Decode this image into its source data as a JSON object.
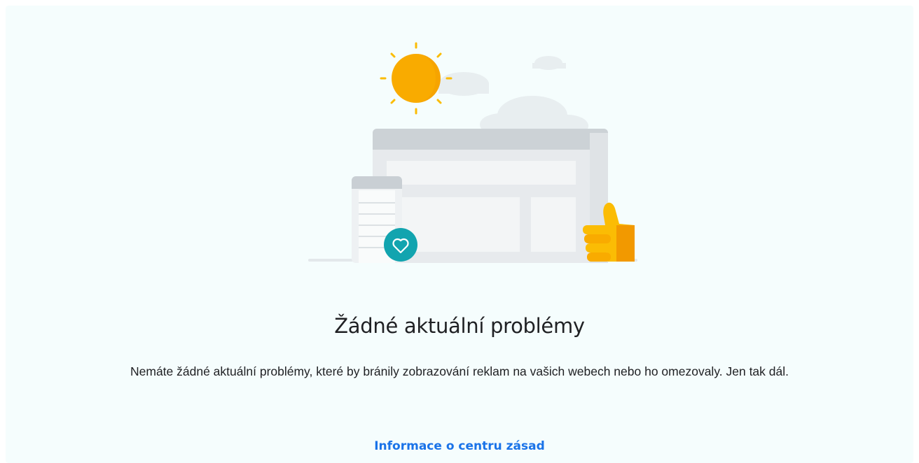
{
  "empty_state": {
    "title": "Žádné aktuální problémy",
    "message": "Nemáte žádné aktuální problémy, které by bránily zobrazování reklam na vašich webech nebo ho omezovaly. Jen tak dál.",
    "link_label": "Informace o centru zásad"
  },
  "colors": {
    "background": "#f5fdfd",
    "sun": "#f9ab00",
    "thumb": "#fbbc04",
    "heart_badge": "#12a4af",
    "link": "#1a73e8",
    "text": "#202124"
  },
  "icons": [
    "sun-icon",
    "cloud-icon",
    "browser-window-icon",
    "mobile-device-icon",
    "heart-icon",
    "thumbs-up-icon"
  ]
}
